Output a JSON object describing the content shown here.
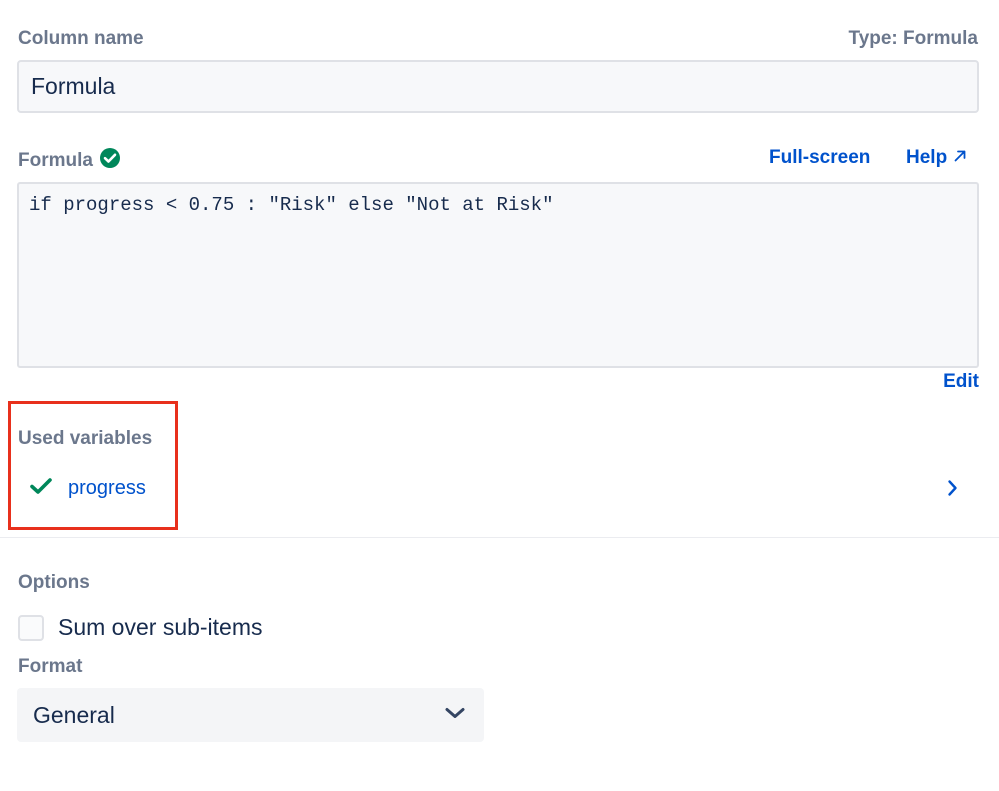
{
  "column_name": {
    "label": "Column name",
    "value": "Formula"
  },
  "type_label": "Type: Formula",
  "formula": {
    "label": "Formula",
    "valid_icon": "check-circle-icon",
    "fullscreen_link": "Full-screen",
    "help_link": "Help",
    "help_icon": "external-arrow-icon",
    "code": "if progress < 0.75 : \"Risk\" else \"Not at Risk\"",
    "edit_link": "Edit"
  },
  "used_variables": {
    "label": "Used variables",
    "items": [
      {
        "name": "progress",
        "status_icon": "checkmark-icon"
      }
    ]
  },
  "options": {
    "label": "Options",
    "sum_over_sub_items": {
      "label": "Sum over sub-items",
      "checked": false
    }
  },
  "format": {
    "label": "Format",
    "selected": "General"
  },
  "colors": {
    "link": "#0052cc",
    "success": "#00875a",
    "highlight_border": "#e8301c",
    "label": "#6b778c",
    "text": "#172b4d"
  }
}
